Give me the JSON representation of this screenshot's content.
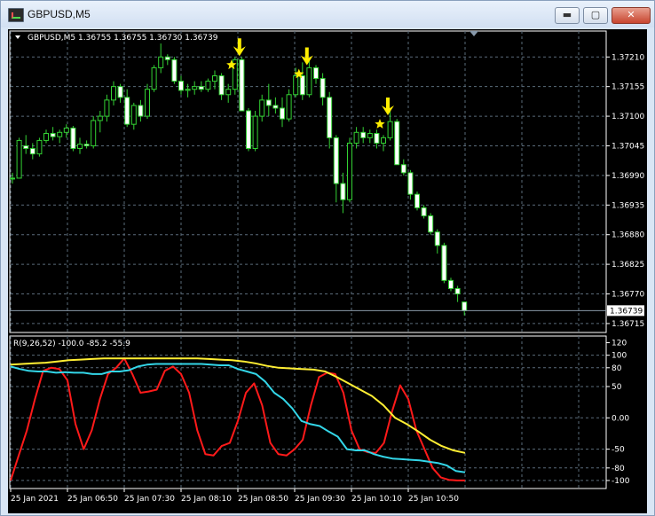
{
  "window": {
    "title": "GBPUSD,M5",
    "controls": {
      "minimize": "▬",
      "maximize": "▢",
      "close": "✕"
    }
  },
  "price_panel": {
    "header": "GBPUSD,M5  1.36755 1.36755 1.36730 1.36739",
    "current_price_label": "1.36739"
  },
  "indicator_panel": {
    "header": "R(9,26,52) -100.0 -85.2 -55.9"
  },
  "chart_data": [
    {
      "type": "candlestick",
      "symbol": "GBPUSD",
      "timeframe": "M5",
      "ohlc_header": [
        1.36755,
        1.36755,
        1.3673,
        1.36739
      ],
      "ylim": [
        1.36705,
        1.37245
      ],
      "y_ticks": [
        "1.37210",
        "1.37155",
        "1.37100",
        "1.37045",
        "1.36990",
        "1.36935",
        "1.36880",
        "1.36825",
        "1.36770",
        "1.36715"
      ],
      "current_price": 1.36739,
      "x_ticks": [
        "25 Jan 2021",
        "25 Jan 06:50",
        "25 Jan 07:30",
        "25 Jan 08:10",
        "25 Jan 08:50",
        "25 Jan 09:30",
        "25 Jan 10:10",
        "25 Jan 10:50"
      ],
      "candles": [
        [
          1.36985,
          1.36995,
          1.36975,
          1.36985
        ],
        [
          1.36985,
          1.3706,
          1.36985,
          1.37055
        ],
        [
          1.37045,
          1.37065,
          1.3703,
          1.3704
        ],
        [
          1.3704,
          1.3705,
          1.3702,
          1.3703
        ],
        [
          1.3703,
          1.3706,
          1.37025,
          1.37055
        ],
        [
          1.37055,
          1.37075,
          1.3705,
          1.37068
        ],
        [
          1.37068,
          1.3708,
          1.37055,
          1.37062
        ],
        [
          1.37062,
          1.37075,
          1.3705,
          1.3707
        ],
        [
          1.3707,
          1.37085,
          1.3706,
          1.37078
        ],
        [
          1.37078,
          1.37082,
          1.37035,
          1.3704
        ],
        [
          1.3704,
          1.3706,
          1.3703,
          1.37048
        ],
        [
          1.37048,
          1.37055,
          1.3704,
          1.37045
        ],
        [
          1.37045,
          1.371,
          1.3704,
          1.37092
        ],
        [
          1.37092,
          1.3711,
          1.3707,
          1.371
        ],
        [
          1.371,
          1.3714,
          1.3709,
          1.3713
        ],
        [
          1.3713,
          1.37165,
          1.3712,
          1.37155
        ],
        [
          1.37155,
          1.3716,
          1.37125,
          1.37135
        ],
        [
          1.37135,
          1.3715,
          1.3708,
          1.37085
        ],
        [
          1.37085,
          1.37125,
          1.37075,
          1.3712
        ],
        [
          1.3712,
          1.3713,
          1.3709,
          1.371
        ],
        [
          1.371,
          1.3716,
          1.37095,
          1.3715
        ],
        [
          1.3715,
          1.37195,
          1.37145,
          1.3719
        ],
        [
          1.3719,
          1.37235,
          1.3718,
          1.3721
        ],
        [
          1.3721,
          1.37215,
          1.37195,
          1.37205
        ],
        [
          1.37205,
          1.3721,
          1.3716,
          1.37165
        ],
        [
          1.37165,
          1.37175,
          1.3714,
          1.37148
        ],
        [
          1.37148,
          1.3716,
          1.37135,
          1.3715
        ],
        [
          1.3715,
          1.37165,
          1.3714,
          1.37155
        ],
        [
          1.37155,
          1.37165,
          1.37145,
          1.3715
        ],
        [
          1.3715,
          1.3717,
          1.37145,
          1.37165
        ],
        [
          1.37165,
          1.37185,
          1.3715,
          1.37175
        ],
        [
          1.37175,
          1.3718,
          1.3713,
          1.3714
        ],
        [
          1.3714,
          1.3716,
          1.37125,
          1.3715
        ],
        [
          1.3715,
          1.3721,
          1.3714,
          1.37205
        ],
        [
          1.37205,
          1.3721,
          1.3711,
          1.3711
        ],
        [
          1.3711,
          1.37115,
          1.37035,
          1.3704
        ],
        [
          1.3704,
          1.3711,
          1.37035,
          1.371
        ],
        [
          1.371,
          1.3714,
          1.3709,
          1.3713
        ],
        [
          1.3713,
          1.3716,
          1.371,
          1.3712
        ],
        [
          1.3712,
          1.37135,
          1.37105,
          1.37115
        ],
        [
          1.37115,
          1.37135,
          1.3708,
          1.37095
        ],
        [
          1.37095,
          1.3715,
          1.3709,
          1.3714
        ],
        [
          1.3714,
          1.3719,
          1.37135,
          1.37175
        ],
        [
          1.37175,
          1.372,
          1.3713,
          1.3714
        ],
        [
          1.3714,
          1.37205,
          1.37135,
          1.3719
        ],
        [
          1.3719,
          1.37195,
          1.3716,
          1.3717
        ],
        [
          1.3717,
          1.3718,
          1.3712,
          1.37135
        ],
        [
          1.37135,
          1.37145,
          1.3704,
          1.3706
        ],
        [
          1.3706,
          1.37065,
          1.3694,
          1.36975
        ],
        [
          1.36975,
          1.36995,
          1.3692,
          1.36945
        ],
        [
          1.36945,
          1.3706,
          1.3694,
          1.3705
        ],
        [
          1.3705,
          1.3708,
          1.3704,
          1.3707
        ],
        [
          1.3707,
          1.3708,
          1.3705,
          1.3706
        ],
        [
          1.3706,
          1.37075,
          1.3705,
          1.37068
        ],
        [
          1.37068,
          1.37075,
          1.3704,
          1.3705
        ],
        [
          1.3705,
          1.37065,
          1.37035,
          1.3706
        ],
        [
          1.3706,
          1.3711,
          1.37055,
          1.3709
        ],
        [
          1.3709,
          1.37095,
          1.3701,
          1.3701
        ],
        [
          1.3701,
          1.3702,
          1.3699,
          1.36995
        ],
        [
          1.36995,
          1.37,
          1.36945,
          1.36955
        ],
        [
          1.36955,
          1.3696,
          1.36925,
          1.3693
        ],
        [
          1.3693,
          1.36935,
          1.3691,
          1.36915
        ],
        [
          1.36915,
          1.3692,
          1.3688,
          1.36885
        ],
        [
          1.36885,
          1.3689,
          1.36845,
          1.3686
        ],
        [
          1.3686,
          1.36865,
          1.3679,
          1.36795
        ],
        [
          1.36795,
          1.368,
          1.36775,
          1.3678
        ],
        [
          1.3678,
          1.36785,
          1.36755,
          1.3677
        ],
        [
          1.36755,
          1.36755,
          1.3673,
          1.36739
        ]
      ],
      "signals": [
        {
          "candle": 33,
          "price": 1.37215
        },
        {
          "candle": 43,
          "price": 1.37198
        },
        {
          "candle": 55,
          "price": 1.37105
        }
      ],
      "colors": {
        "bull": "#000000",
        "bear": "#ffffff",
        "outline": "#33d233",
        "signal_arrow": "#ffee00",
        "signal_star": "#ffee00",
        "grid": "#5a6b7a"
      }
    },
    {
      "type": "line",
      "name": "R(9,26,52)",
      "ylim": [
        -110,
        125
      ],
      "y_ticks": [
        "120",
        "100",
        "80",
        "50",
        "0.00",
        "-50",
        "-80",
        "-100"
      ],
      "series": [
        {
          "name": "R9",
          "color": "#ff1a1a",
          "values": [
            -100,
            -60,
            -20,
            30,
            75,
            80,
            78,
            60,
            -10,
            -50,
            -20,
            30,
            70,
            80,
            95,
            70,
            40,
            42,
            45,
            75,
            82,
            70,
            40,
            -20,
            -58,
            -60,
            -45,
            -40,
            -5,
            40,
            55,
            20,
            -40,
            -58,
            -60,
            -50,
            -35,
            20,
            65,
            72,
            70,
            40,
            -20,
            -50,
            -55,
            -56,
            -40,
            10,
            52,
            30,
            -20,
            -50,
            -80,
            -95,
            -99,
            -100,
            -100
          ]
        },
        {
          "name": "R26",
          "color": "#33d6e8",
          "values": [
            82,
            78,
            75,
            74,
            74,
            72,
            73,
            72,
            72,
            70,
            70,
            74,
            74,
            76,
            82,
            85,
            86,
            86,
            86,
            86,
            86,
            86,
            85,
            84,
            84,
            78,
            74,
            70,
            58,
            40,
            30,
            15,
            -5,
            -10,
            -13,
            -22,
            -30,
            -50,
            -52,
            -52,
            -58,
            -62,
            -65,
            -66,
            -67,
            -68,
            -70,
            -72,
            -76,
            -85,
            -87
          ]
        },
        {
          "name": "R52",
          "color": "#ffee33",
          "values": [
            85,
            86,
            87,
            88,
            90,
            92,
            93,
            94,
            95,
            95,
            95,
            95,
            95,
            95,
            95,
            95,
            95,
            94,
            93,
            92,
            90,
            87,
            83,
            80,
            79,
            78,
            77,
            74,
            65,
            55,
            45,
            35,
            20,
            0,
            -10,
            -22,
            -35,
            -45,
            -52,
            -55.9
          ]
        }
      ]
    }
  ]
}
